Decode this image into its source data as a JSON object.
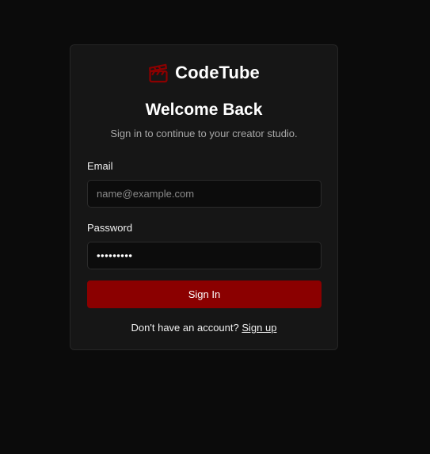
{
  "brand": {
    "name": "CodeTube",
    "icon": "clapperboard-icon",
    "accent": "#8b0000"
  },
  "heading": {
    "title": "Welcome Back",
    "subtitle": "Sign in to continue to your creator studio."
  },
  "form": {
    "email_label": "Email",
    "email_placeholder": "name@example.com",
    "email_value": "",
    "password_label": "Password",
    "password_value": "passwords"
  },
  "actions": {
    "submit_label": "Sign In"
  },
  "footer": {
    "prompt": "Don't have an account?",
    "link_label": "Sign up"
  },
  "colors": {
    "background": "#0b0b0b",
    "card": "#161616",
    "button": "#8b0000"
  }
}
